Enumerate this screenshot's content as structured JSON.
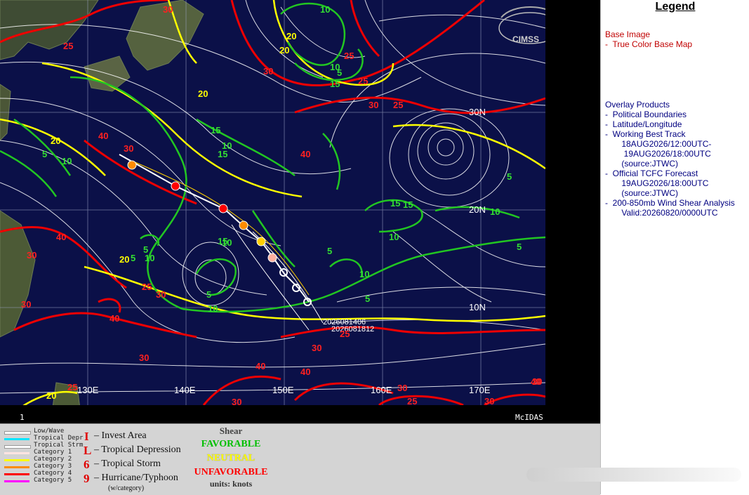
{
  "map": {
    "lat_labels": [
      "30N",
      "20N",
      "10N"
    ],
    "lon_labels": [
      "130E",
      "140E",
      "150E",
      "160E",
      "170E"
    ],
    "frame_number": "1",
    "mcidas_label": "McIDAS",
    "logo_text": "CIMSS",
    "track_annotation_1": "2026081406",
    "track_annotation_2": "2026081812",
    "contour_labels": {
      "red": [
        "30",
        "25",
        "30",
        "25",
        "25",
        "30",
        "25",
        "40",
        "40",
        "30",
        "40",
        "30",
        "25",
        "30",
        "40",
        "40",
        "30",
        "30",
        "25",
        "30",
        "40",
        "25",
        "30",
        "20",
        "30",
        "25",
        "40",
        "30"
      ],
      "yellow": [
        "20",
        "20",
        "20",
        "20",
        "20",
        "20"
      ],
      "green": [
        "10",
        "10",
        "15",
        "15",
        "15",
        "10",
        "5",
        "10",
        "15",
        "10",
        "5",
        "5",
        "10",
        "15",
        "5",
        "10",
        "5",
        "5",
        "5",
        "10",
        "5",
        "10",
        "5",
        "15",
        "10"
      ]
    }
  },
  "legend": {
    "title": "Legend",
    "base_image_header": "Base Image",
    "base_image_item": "-  True Color Base Map",
    "overlay_header": "Overlay Products",
    "overlay_items": [
      "-  Political Boundaries",
      "-  Latitude/Longitude",
      "-  Working Best Track",
      "       18AUG2026/12:00UTC-",
      "        19AUG2026/18:00UTC",
      "       (source:JTWC)",
      "-  Official TCFC Forecast",
      "       19AUG2026/18:00UTC",
      "       (source:JTWC)",
      "-  200-850mb Wind Shear Analysis",
      "       Valid:20260820/0000UTC"
    ]
  },
  "key": {
    "lines": [
      {
        "label": "Low/Wave",
        "color": "#ffffff"
      },
      {
        "label": "Tropical Depr",
        "color": "#00e5ff"
      },
      {
        "label": "Tropical Strm",
        "color": "#ffffff"
      },
      {
        "label": "Category 1",
        "color": "#ffe4e1"
      },
      {
        "label": "Category 2",
        "color": "#ffff00"
      },
      {
        "label": "Category 3",
        "color": "#ff8c00"
      },
      {
        "label": "Category 4",
        "color": "#ff0000"
      },
      {
        "label": "Category 5",
        "color": "#ff00ff"
      }
    ],
    "symbols": [
      {
        "glyph": "I",
        "label": "– Invest Area"
      },
      {
        "glyph": "L",
        "label": "– Tropical Depression"
      },
      {
        "glyph": "6",
        "label": "– Tropical Storm"
      },
      {
        "glyph": "9",
        "label": "– Hurricane/Typhoon"
      }
    ],
    "category_note": "(w/category)",
    "shear_title": "Shear",
    "favorable": "FAVORABLE",
    "neutral": "NEUTRAL",
    "unfavorable": "UNFAVORABLE",
    "units": "units: knots"
  },
  "colors": {
    "favorable": "#00c000",
    "neutral": "#ffff00",
    "unfavorable": "#ff0000",
    "ocean": "#0b1048",
    "streamline": "#ffffff"
  }
}
